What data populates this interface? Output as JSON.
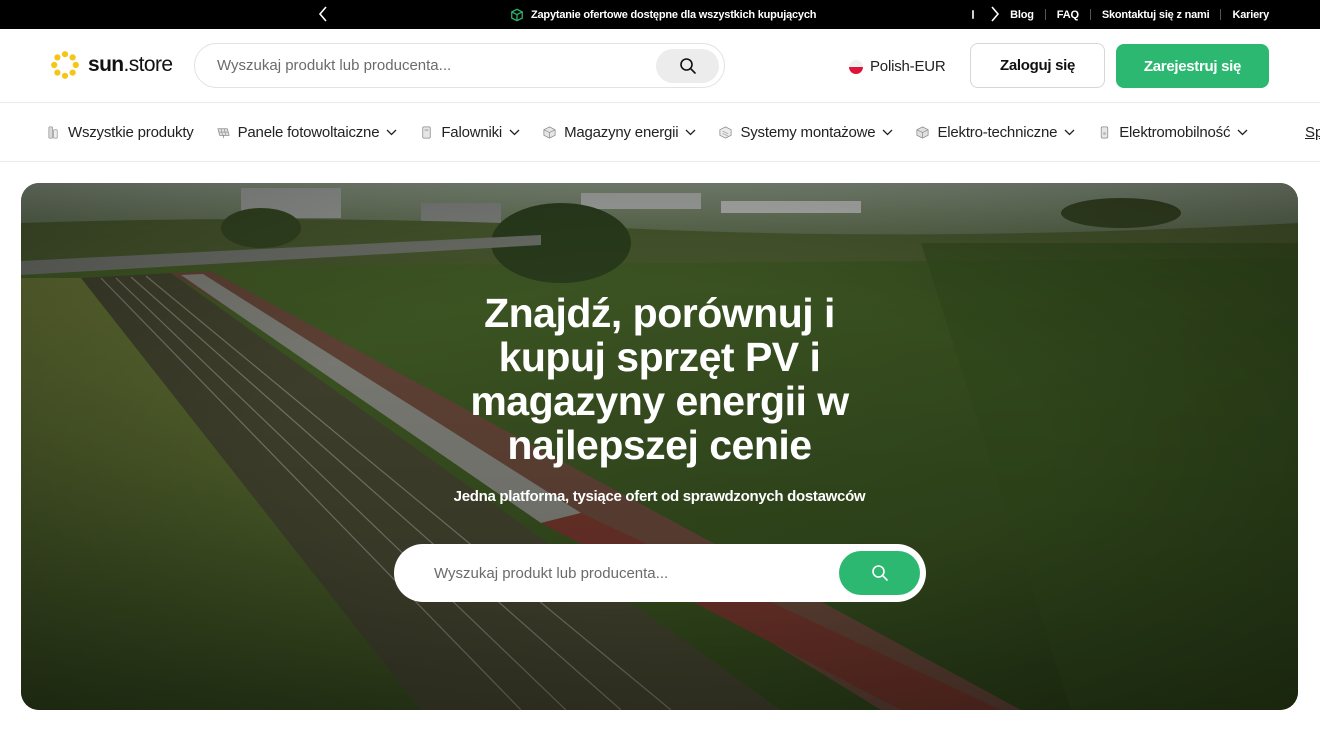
{
  "topbar": {
    "announcement": "Zapytanie ofertowe dostępne dla wszystkich kupujących",
    "links": [
      "Blog",
      "FAQ",
      "Skontaktuj się z nami",
      "Kariery"
    ]
  },
  "header": {
    "brand_bold": "sun",
    "brand_rest": ".store",
    "search_placeholder": "Wyszukaj produkt lub producenta...",
    "language": "Polish-EUR",
    "login_label": "Zaloguj się",
    "register_label": "Zarejestruj się"
  },
  "nav": {
    "items": [
      {
        "label": "Wszystkie produkty",
        "icon": "all-products-icon"
      },
      {
        "label": "Panele fotowoltaiczne",
        "icon": "solar-panel-icon"
      },
      {
        "label": "Falowniki",
        "icon": "inverter-icon"
      },
      {
        "label": "Magazyny energii",
        "icon": "battery-icon"
      },
      {
        "label": "Systemy montażowe",
        "icon": "mounting-icon"
      },
      {
        "label": "Elektro-techniczne",
        "icon": "electrical-icon"
      },
      {
        "label": "Elektromobilność",
        "icon": "ev-charger-icon"
      }
    ],
    "overflow_label": "Sp"
  },
  "hero": {
    "title_lines": [
      "Znajdź, porównuj i",
      "kupuj sprzęt PV i",
      "magazyny energii w",
      "najlepszej cenie"
    ],
    "subtitle": "Jedna platforma, tysiące ofert od sprawdzonych dostawców",
    "search_placeholder": "Wyszukaj produkt lub producenta..."
  },
  "colors": {
    "accent": "#2db871",
    "topbar_bg": "#000000",
    "flag_red": "#dc143c"
  }
}
